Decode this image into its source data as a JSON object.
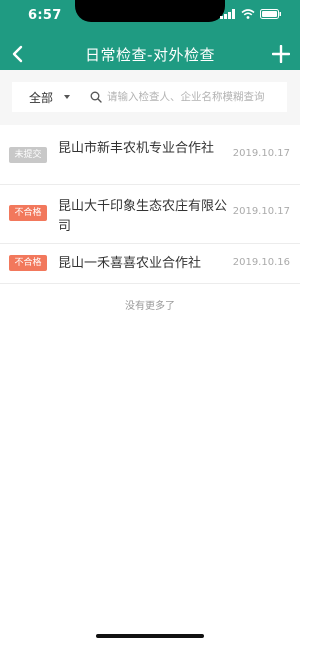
{
  "status_bar": {
    "time": "6:57"
  },
  "nav": {
    "title": "日常检查-对外检查",
    "back_icon": "chevron-left-icon",
    "add_icon": "plus-icon"
  },
  "filter": {
    "selected": "全部",
    "search_placeholder": "请输入检查人、企业名称模糊查询",
    "search_value": ""
  },
  "colors": {
    "brand": "#1f9b82",
    "badge_unsubmitted": "#c8c8c8",
    "badge_fail": "#f2785c"
  },
  "records": [
    {
      "status": "未提交",
      "status_type": "unsubmitted",
      "name": "昆山市新丰农机专业合作社",
      "date": "2019.10.17"
    },
    {
      "status": "不合格",
      "status_type": "fail",
      "name": "昆山大千印象生态农庄有限公司",
      "date": "2019.10.17"
    },
    {
      "status": "不合格",
      "status_type": "fail",
      "name": "昆山一禾喜喜农业合作社",
      "date": "2019.10.16"
    }
  ],
  "footer": {
    "no_more": "没有更多了"
  }
}
